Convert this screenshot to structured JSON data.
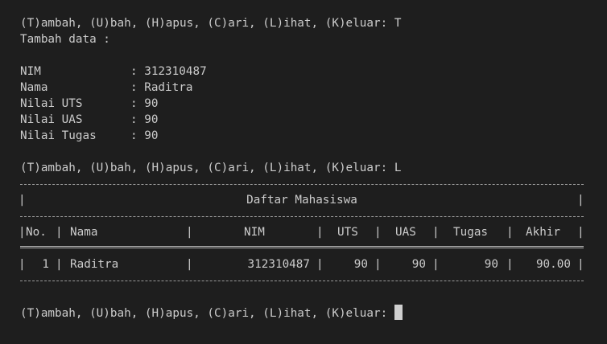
{
  "session": {
    "prompt_menu": "(T)ambah, (U)bah, (H)apus, (C)ari, (L)ihat, (K)eluar: ",
    "first_choice": "T",
    "add_header": "Tambah data :",
    "fields": [
      {
        "label": "NIM",
        "value": "312310487"
      },
      {
        "label": "Nama",
        "value": "Raditra"
      },
      {
        "label": "Nilai UTS",
        "value": "90"
      },
      {
        "label": "Nilai UAS",
        "value": "90"
      },
      {
        "label": "Nilai Tugas",
        "value": "90"
      }
    ],
    "second_choice": "L"
  },
  "table": {
    "title": "Daftar Mahasiswa",
    "columns": [
      "No.",
      "Nama",
      "NIM",
      "UTS",
      "UAS",
      "Tugas",
      "Akhir"
    ],
    "rows": [
      {
        "no": "1",
        "nama": "Raditra",
        "nim": "312310487",
        "uts": "90",
        "uas": "90",
        "tugas": "90",
        "akhir": "90.00"
      }
    ]
  },
  "colors": {
    "background": "#1e1e1e",
    "text": "#cccccc",
    "cursor": "#cfcfcf"
  }
}
